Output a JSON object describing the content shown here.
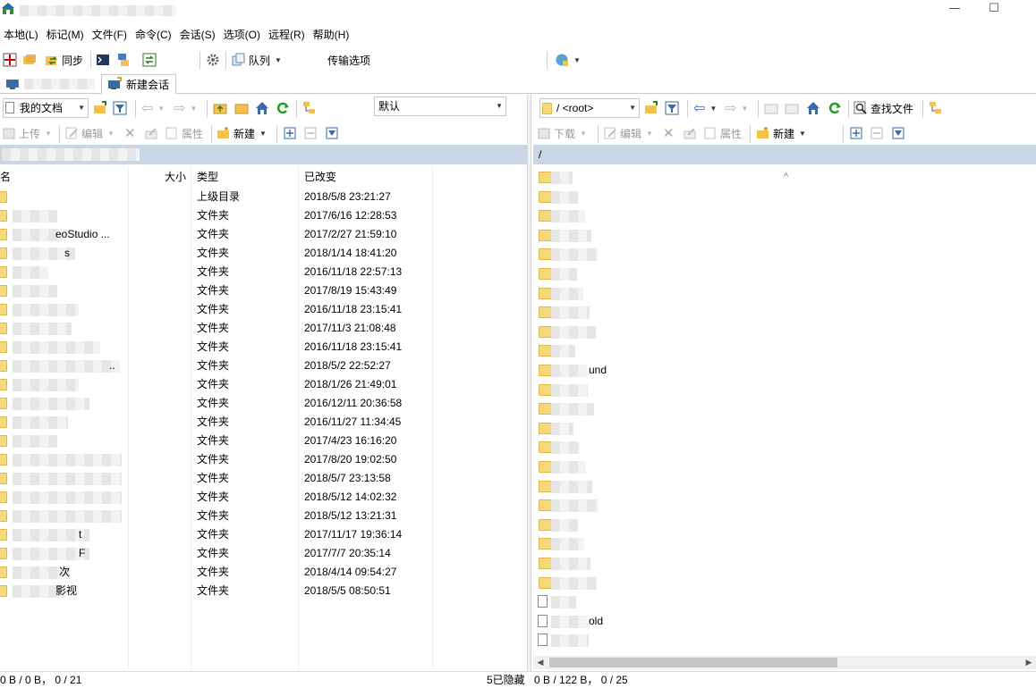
{
  "window": {
    "min_label": "—",
    "max_label": "☐"
  },
  "menu": [
    "本地(L)",
    "标记(M)",
    "文件(F)",
    "命令(C)",
    "会话(S)",
    "选项(O)",
    "远程(R)",
    "帮助(H)"
  ],
  "toolbar": {
    "sync_label": "同步",
    "queue_label": "队列",
    "transfer_label": "传输选项",
    "transfer_value": "默认"
  },
  "tabs": {
    "new_session_label": "新建会话"
  },
  "left_panel": {
    "location": "我的文档",
    "upload_label": "上传",
    "edit_label": "编辑",
    "properties_label": "属性",
    "new_label": "新建",
    "columns": {
      "name": "名",
      "size": "大小",
      "type": "类型",
      "changed": "已改变"
    },
    "rows": [
      {
        "name": "",
        "type": "上级目录",
        "changed": "2018/5/8  23:21:27"
      },
      {
        "name": "",
        "type": "文件夹",
        "changed": "2017/6/16  12:28:53"
      },
      {
        "name": "eoStudio ...",
        "type": "文件夹",
        "changed": "2017/2/27  21:59:10"
      },
      {
        "name": "s",
        "type": "文件夹",
        "changed": "2018/1/14  18:41:20"
      },
      {
        "name": "",
        "type": "文件夹",
        "changed": "2016/11/18  22:57:13"
      },
      {
        "name": "",
        "type": "文件夹",
        "changed": "2017/8/19  15:43:49"
      },
      {
        "name": "",
        "type": "文件夹",
        "changed": "2016/11/18  23:15:41"
      },
      {
        "name": "",
        "type": "文件夹",
        "changed": "2017/11/3  21:08:48"
      },
      {
        "name": "",
        "type": "文件夹",
        "changed": "2016/11/18  23:15:41"
      },
      {
        "name": "..",
        "type": "文件夹",
        "changed": "2018/5/2  22:52:27"
      },
      {
        "name": "",
        "type": "文件夹",
        "changed": "2018/1/26  21:49:01"
      },
      {
        "name": "",
        "type": "文件夹",
        "changed": "2016/12/11  20:36:58"
      },
      {
        "name": "",
        "type": "文件夹",
        "changed": "2016/11/27  11:34:45"
      },
      {
        "name": "",
        "type": "文件夹",
        "changed": "2017/4/23  16:16:20"
      },
      {
        "name": "",
        "type": "文件夹",
        "changed": "2017/8/20  19:02:50"
      },
      {
        "name": "",
        "type": "文件夹",
        "changed": "2018/5/7  23:13:58"
      },
      {
        "name": "",
        "type": "文件夹",
        "changed": "2018/5/12  14:02:32"
      },
      {
        "name": "",
        "type": "文件夹",
        "changed": "2018/5/12  13:21:31"
      },
      {
        "name": "t",
        "type": "文件夹",
        "changed": "2017/11/17  19:36:14"
      },
      {
        "name": "F",
        "type": "文件夹",
        "changed": "2017/7/7  20:35:14"
      },
      {
        "name": "次",
        "type": "文件夹",
        "changed": "2018/4/14  09:54:27"
      },
      {
        "name": "影视",
        "type": "文件夹",
        "changed": "2018/5/5  08:50:51"
      }
    ],
    "status_left": "0 B / 0 B，  0 / 21",
    "status_right": "5已隐藏"
  },
  "right_panel": {
    "location": "/ <root>",
    "find_label": "查找文件",
    "download_label": "下载",
    "edit_label": "编辑",
    "properties_label": "属性",
    "new_label": "新建",
    "path": "/",
    "sort_indicator": "^",
    "visible_names": [
      "und",
      "old"
    ],
    "status": "0 B / 122 B，  0 / 25"
  }
}
